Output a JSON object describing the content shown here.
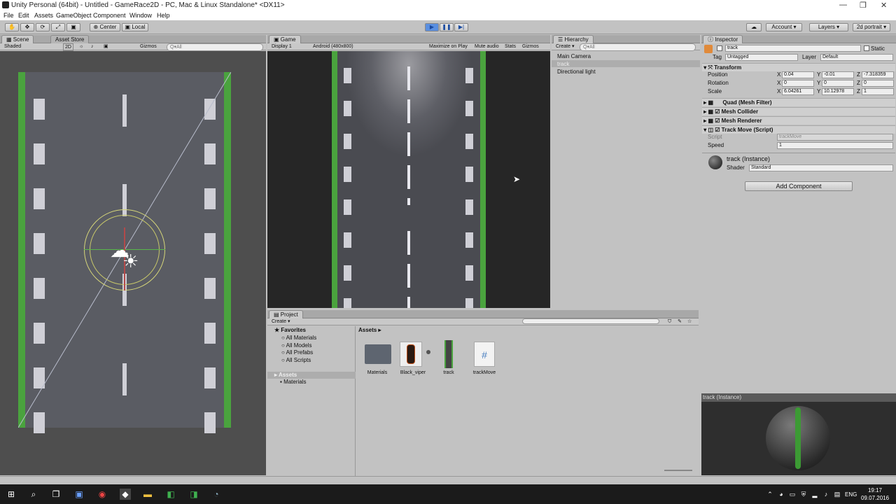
{
  "window": {
    "title": "Unity Personal (64bit) - Untitled - GameRace2D - PC, Mac & Linux Standalone* <DX11>"
  },
  "menu": [
    "File",
    "Edit",
    "Assets",
    "GameObject",
    "Component",
    "Window",
    "Help"
  ],
  "toolbar": {
    "center": "Center",
    "local": "Local",
    "account": "Account",
    "layers": "Layers",
    "layout": "2d portrait"
  },
  "scene": {
    "tab": "Scene",
    "tab2": "Asset Store",
    "shaded": "Shaded",
    "mode2d": "2D",
    "gizmos": "Gizmos",
    "search": "Q▾All"
  },
  "game": {
    "tab": "Game",
    "display": "Display 1",
    "resolution": "Android (480x800)",
    "maximize": "Maximize on Play",
    "mute": "Mute audio",
    "stats": "Stats",
    "gizmos": "Gizmos"
  },
  "hierarchy": {
    "tab": "Hierarchy",
    "create": "Create ▾",
    "search": "Q▾All",
    "items": [
      "Main Camera",
      "track",
      "Directional light"
    ]
  },
  "inspector": {
    "tab": "Inspector",
    "object_name": "track",
    "static": "Static",
    "tag_label": "Tag",
    "tag": "Untagged",
    "layer_label": "Layer",
    "layer": "Default",
    "transform": "Transform",
    "position_label": "Position",
    "rotation_label": "Rotation",
    "scale_label": "Scale",
    "pos": {
      "x": "0.04",
      "y": "-0.01",
      "z": "-7.318359"
    },
    "rot": {
      "x": "0",
      "y": "0",
      "z": "0"
    },
    "scl": {
      "x": "6.04261",
      "y": "10.12978",
      "z": "1"
    },
    "comp_meshfilter": "Quad (Mesh Filter)",
    "comp_collider": "Mesh Collider",
    "comp_renderer": "Mesh Renderer",
    "comp_script": "Track Move (Script)",
    "script_label": "Script",
    "script_value": "trackMove",
    "speed_label": "Speed",
    "speed_value": "1",
    "material_name": "track (Instance)",
    "shader_label": "Shader",
    "shader_value": "Standard",
    "add_component": "Add Component",
    "preview_title": "track (Instance)"
  },
  "project": {
    "tab": "Project",
    "create": "Create ▾",
    "favorites": "Favorites",
    "fav_items": [
      "All Materials",
      "All Models",
      "All Prefabs",
      "All Scripts"
    ],
    "assets_root": "Assets",
    "asset_folders": [
      "Materials"
    ],
    "breadcrumb": "Assets ▸",
    "assets": [
      "Materials",
      "Black_viper",
      "track",
      "trackMove"
    ]
  },
  "taskbar": {
    "lang": "ENG",
    "time": "19:17",
    "date": "09.07.2016"
  }
}
